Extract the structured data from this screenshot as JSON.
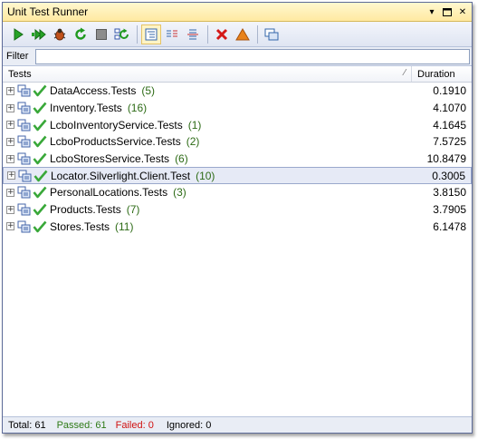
{
  "window": {
    "title": "Unit Test Runner"
  },
  "toolbar": {
    "icons": [
      "run-icon",
      "run-all-icon",
      "debug-icon",
      "refresh-icon",
      "stop-icon",
      "rerun-failed-icon",
      "view-tree-icon",
      "view-list-icon",
      "view-split-icon",
      "delete-icon",
      "warning-icon",
      "window-icon"
    ]
  },
  "filter": {
    "label": "Filter",
    "value": ""
  },
  "grid": {
    "col_tests": "Tests",
    "col_duration": "Duration",
    "rows": [
      {
        "name": "DataAccess.Tests",
        "count": "(5)",
        "duration": "0.1910"
      },
      {
        "name": "Inventory.Tests",
        "count": "(16)",
        "duration": "4.1070"
      },
      {
        "name": "LcboInventoryService.Tests",
        "count": "(1)",
        "duration": "4.1645"
      },
      {
        "name": "LcboProductsService.Tests",
        "count": "(2)",
        "duration": "7.5725"
      },
      {
        "name": "LcboStoresService.Tests",
        "count": "(6)",
        "duration": "10.8479"
      },
      {
        "name": "Locator.Silverlight.Client.Test",
        "count": "(10)",
        "duration": "0.3005"
      },
      {
        "name": "PersonalLocations.Tests",
        "count": "(3)",
        "duration": "3.8150"
      },
      {
        "name": "Products.Tests",
        "count": "(7)",
        "duration": "3.7905"
      },
      {
        "name": "Stores.Tests",
        "count": "(11)",
        "duration": "6.1478"
      }
    ]
  },
  "status": {
    "total": "Total: 61",
    "passed": "Passed: 61",
    "failed": "Failed: 0",
    "ignored": "Ignored: 0"
  },
  "colors": {
    "passed": "#2d7a16",
    "failed": "#d01010",
    "selected_row": "#e6eaf6"
  }
}
